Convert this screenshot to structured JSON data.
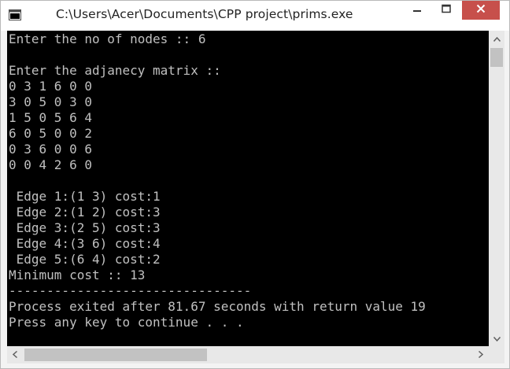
{
  "window": {
    "title": "C:\\Users\\Acer\\Documents\\CPP project\\prims.exe"
  },
  "icons": {
    "app": "console-app-icon",
    "minimize": "minimize-icon",
    "maximize": "maximize-icon",
    "close": "close-icon",
    "scroll_up": "arrow-up-icon",
    "scroll_down": "arrow-down-icon",
    "scroll_left": "arrow-left-icon",
    "scroll_right": "arrow-right-icon"
  },
  "colors": {
    "console_background": "#000000",
    "console_text": "#c0c0c0",
    "close_button": "#c7504b",
    "titlebar": "#ffffff"
  },
  "console": {
    "lines": [
      "Enter the no of nodes :: 6",
      "",
      "Enter the adjanecy matrix ::",
      "0 3 1 6 0 0",
      "3 0 5 0 3 0",
      "1 5 0 5 6 4",
      "6 0 5 0 0 2",
      "0 3 6 0 0 6",
      "0 0 4 2 6 0",
      "",
      " Edge 1:(1 3) cost:1",
      " Edge 2:(1 2) cost:3",
      " Edge 3:(2 5) cost:3",
      " Edge 4:(3 6) cost:4",
      " Edge 5:(6 4) cost:2",
      "Minimum cost :: 13",
      "--------------------------------",
      "Process exited after 81.67 seconds with return value 19",
      "Press any key to continue . . ."
    ]
  }
}
